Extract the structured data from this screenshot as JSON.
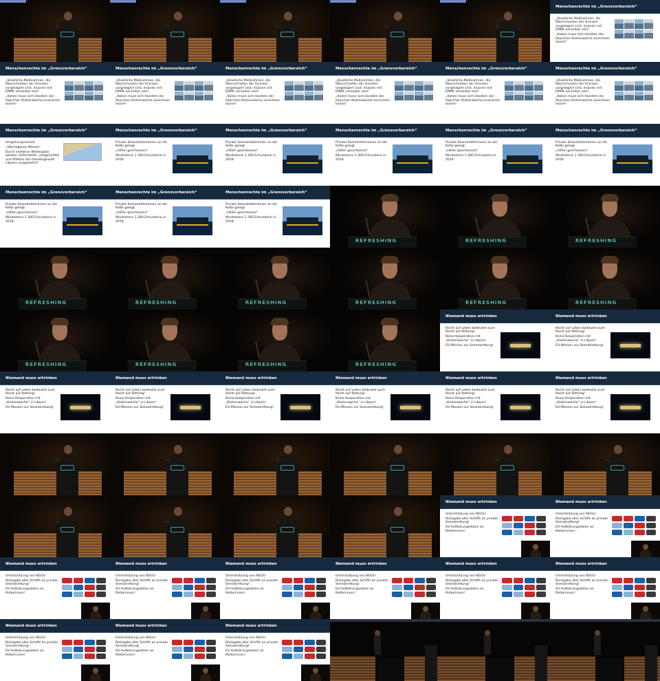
{
  "slides": {
    "grenz": {
      "header": "Menschenrechte im „Grenzvorbereich“",
      "body_a": [
        "„Staatliche Maßnahmen, die Überschreiten der Grenzen vorgelagert sind, müssen mit EMRK vereinbar sein“",
        "„Italien muss sich Handeln der libyschen Küstenwache zurechnen lassen“"
      ],
      "body_b": [
        "Umgehungsverbot",
        "„Überlegenes Wissen“",
        "Durch selektive Weitergabe werden Geflüchtete „zielgerichtet und effektiv der Hoheitsgewalt Libyens ausgeliefert“"
      ],
      "body_c": [
        "Private SeenotretterInnen an die Kette gelegt",
        "„Häfen geschlossen“",
        "Mindestens 1.300 Ertrunkene in 2018"
      ]
    },
    "niemand": {
      "header": "Niemand muss ertrinken",
      "body_a": [
        "Recht auf Leben bedeutet auch Recht auf Rettung!",
        "Keine Kooperation mit „Küstenwache“ in Libyen!",
        "EU-Mission zur Seenotrettung!"
      ],
      "body_b": [
        "Unterstützung von NGOs!",
        "Rückgabe aller Schiffe an private Seenotrettung!",
        "EU-Aufklärungsdaten an Retterinnen!"
      ]
    },
    "desk_text": "REFRESHING"
  },
  "tiles": [
    "stage",
    "stage",
    "stage",
    "stage",
    "stage",
    "grenz_a",
    "grenz_a",
    "grenz_a",
    "grenz_a",
    "grenz_a",
    "grenz_a",
    "grenz_a",
    "grenz_b",
    "grenz_c",
    "grenz_c",
    "grenz_c",
    "grenz_c",
    "grenz_c",
    "grenz_c",
    "grenz_c",
    "grenz_c",
    "speaker",
    "speaker",
    "speaker",
    "speaker",
    "speaker",
    "speaker",
    "speaker",
    "speaker",
    "speaker",
    "speaker",
    "speaker",
    "speaker",
    "speaker",
    "niemand_a",
    "niemand_a",
    "niemand_a",
    "niemand_a",
    "niemand_a",
    "niemand_a",
    "niemand_a",
    "niemand_a",
    "stage",
    "stage",
    "stage",
    "stage",
    "stage",
    "stage",
    "stage",
    "stage",
    "stage",
    "stage",
    "niemand_b",
    "niemand_b",
    "niemand_b",
    "niemand_b",
    "niemand_b",
    "niemand_b",
    "niemand_b",
    "niemand_b",
    "niemand_b",
    "niemand_b",
    "niemand_b",
    "dark",
    "dark",
    "dark"
  ]
}
